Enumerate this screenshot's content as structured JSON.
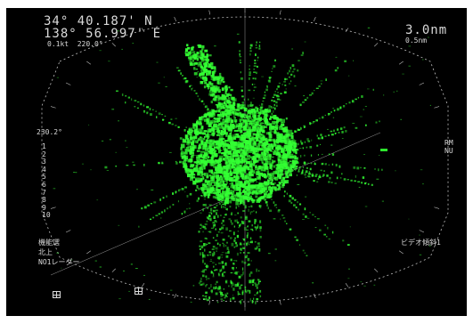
{
  "header": {
    "latitude": "34° 40.187' N",
    "longitude": "138° 56.997' E",
    "speed_course": "0.1kt  220.0°",
    "range": "3.0nm",
    "ring_interval": "0.5nm"
  },
  "left_panel": {
    "bearing_readout": "230.2°",
    "range_scale": [
      "1",
      "2",
      "3",
      "4",
      "5",
      "6",
      "7",
      "8",
      "9",
      "10"
    ],
    "mode_label": "機能選",
    "sub_label": "北上",
    "radar_name": "NO1レーダー"
  },
  "right_panel": {
    "motion_mode": "RM",
    "orientation": "NU",
    "video_label": "ビデオ傾斜1"
  },
  "colors": {
    "echo": "#33ff33",
    "screen": "#000000",
    "text": "#d9d9d9",
    "rings": "#bfbfbf"
  },
  "icons": {
    "bottom_left": "grid-box-icon",
    "bottom_center": "target-box-icon"
  }
}
